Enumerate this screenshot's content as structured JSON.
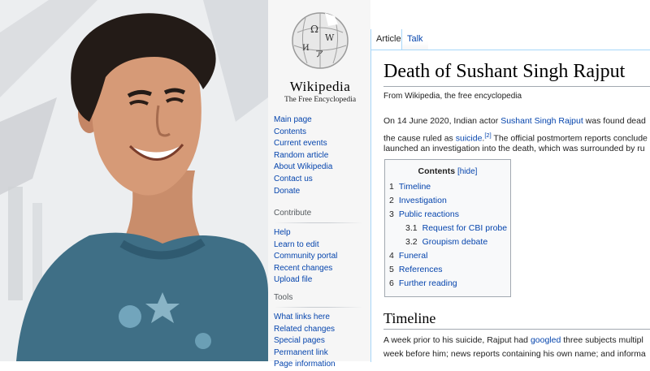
{
  "sidebar": {
    "wordmark": "Wikipedia",
    "tagline": "The Free Encyclopedia",
    "main_nav": [
      "Main page",
      "Contents",
      "Current events",
      "Random article",
      "About Wikipedia",
      "Contact us",
      "Donate"
    ],
    "contribute_heading": "Contribute",
    "contribute_nav": [
      "Help",
      "Learn to edit",
      "Community portal",
      "Recent changes",
      "Upload file"
    ],
    "tools_heading": "Tools",
    "tools_nav": [
      "What links here",
      "Related changes",
      "Special pages",
      "Permanent link",
      "Page information"
    ]
  },
  "tabs": {
    "article": "Article",
    "talk": "Talk"
  },
  "article": {
    "title": "Death of Sushant Singh Rajput",
    "from": "From Wikipedia, the free encyclopedia",
    "intro": {
      "l1_a": "On 14 June 2020, Indian actor ",
      "l1_link": "Sushant Singh Rajput",
      "l1_b": " was found dead",
      "l2_a": "the cause ruled as ",
      "l2_link": "suicide",
      "l2_ref": "[2]",
      "l2_b": " The official postmortem reports conclude",
      "l3": "launched an investigation into the death, which was surrounded by ru"
    },
    "toc": {
      "title": "Contents",
      "hide": "[hide]",
      "items": [
        {
          "num": "1",
          "text": "Timeline"
        },
        {
          "num": "2",
          "text": "Investigation"
        },
        {
          "num": "3",
          "text": "Public reactions"
        },
        {
          "num": "3.1",
          "text": "Request for CBI probe"
        },
        {
          "num": "3.2",
          "text": "Groupism debate"
        },
        {
          "num": "4",
          "text": "Funeral"
        },
        {
          "num": "5",
          "text": "References"
        },
        {
          "num": "6",
          "text": "Further reading"
        }
      ]
    },
    "section_heading": "Timeline",
    "section": {
      "l1_a": "A week prior to his suicide, Rajput had ",
      "l1_link": "googled",
      "l1_b": " three subjects multipl",
      "l2": "week before him; news reports containing his own name; and informa"
    }
  },
  "colors": {
    "link": "#0645ad",
    "sidebar_bg": "#f6f6f6",
    "border": "#a2a9b1",
    "tab_border": "#a7d7f9"
  }
}
